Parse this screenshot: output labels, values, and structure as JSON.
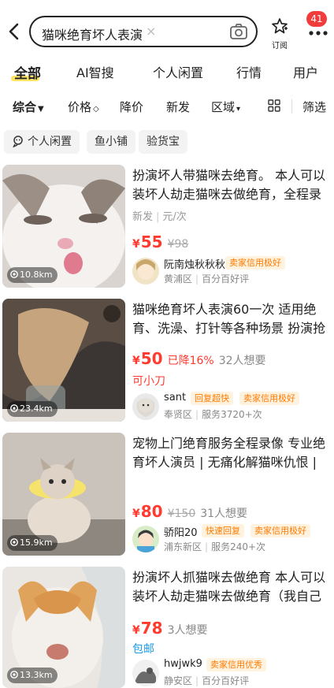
{
  "search": {
    "query": "猫咪绝育坏人表演",
    "clear": "×"
  },
  "header": {
    "subscribe_label": "订阅",
    "notification_count": "41"
  },
  "category_tabs": [
    {
      "label": "全部",
      "active": true
    },
    {
      "label": "AI智搜"
    },
    {
      "label": "个人闲置"
    },
    {
      "label": "行情"
    },
    {
      "label": "用户"
    }
  ],
  "sort_bar": {
    "comprehensive": "综合",
    "price": "价格",
    "price_drop": "降价",
    "new": "新发",
    "region": "区域",
    "filter": "筛选"
  },
  "chips": [
    "个人闲置",
    "鱼小铺",
    "验货宝"
  ],
  "listings": [
    {
      "title": "扮演坏人带猫咪去绝育。 本人可以装坏人劫走猫咪去做绝育，全程录",
      "tags": [
        "新发",
        "元/次"
      ],
      "price": "55",
      "original_price": "¥98",
      "distance": "10.8km",
      "seller": {
        "name": "阮南烛秋秋秋",
        "badges": [
          "卖家信用极好"
        ],
        "location": "黄浦区",
        "stat": "百分百好评"
      }
    },
    {
      "title": "猫咪绝育坏人表演60一次 适用绝育、洗澡、打针等各种场景 扮演抢",
      "price": "50",
      "drop": "已降16%",
      "want": "32人想要",
      "extra": "可小刀",
      "distance": "23.4km",
      "seller": {
        "name": "sant",
        "badges": [
          "回复超快",
          "卖家信用极好"
        ],
        "location": "奉贤区",
        "stat": "服务3720+次"
      }
    },
    {
      "title": "宠物上门绝育服务全程录像 专业绝育坏人演员 | 无痛化解猫咪仇恨 |",
      "price": "80",
      "original_price": "¥150",
      "want": "31人想要",
      "distance": "15.9km",
      "seller": {
        "name": "骄阳20",
        "badges": [
          "快速回复",
          "卖家信用极好"
        ],
        "location": "浦东新区",
        "stat": "服务240+次"
      }
    },
    {
      "title": "扮演坏人抓猫咪去做绝育 本人可以装坏人劫走猫咪去做绝育（我自己",
      "price": "78",
      "want": "3人想要",
      "extra": "包邮",
      "distance": "13.3km",
      "seller": {
        "name": "hwjwk9",
        "badges": [
          "卖家信用优秀"
        ],
        "location": "静安区",
        "stat": "百分百好评"
      }
    }
  ]
}
